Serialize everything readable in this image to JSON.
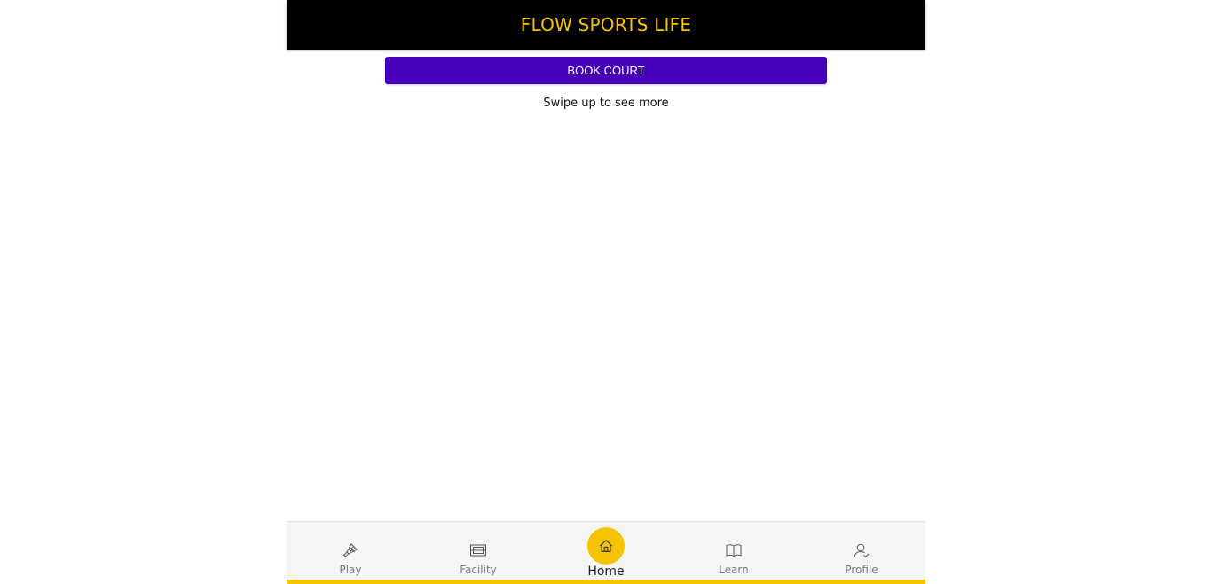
{
  "header": {
    "title": "FLOW SPORTS LIFE"
  },
  "main": {
    "book_button_label": "BOOK COURT",
    "swipe_hint": "Swipe up to see more"
  },
  "bottom_nav": {
    "items": [
      {
        "label": "Play",
        "icon": "shuttlecock-icon"
      },
      {
        "label": "Facility",
        "icon": "court-icon"
      },
      {
        "label": "Home",
        "icon": "home-icon",
        "active": true
      },
      {
        "label": "Learn",
        "icon": "book-icon"
      },
      {
        "label": "Profile",
        "icon": "user-icon"
      }
    ]
  },
  "colors": {
    "header_bg": "#000000",
    "brand_yellow": "#f5c400",
    "button_purple": "#4600b8",
    "nav_bg": "#f5f5f5"
  }
}
